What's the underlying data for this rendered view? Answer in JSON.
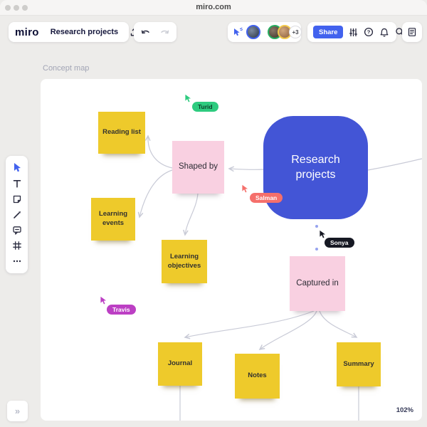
{
  "window": {
    "title": "miro.com"
  },
  "header": {
    "logo": "miro",
    "board_name": "Research projects",
    "share_label": "Share",
    "presence_overflow": "+3",
    "accent": "#4262ee"
  },
  "frame": {
    "label": "Concept map",
    "zoom": "102%",
    "collapse_glyph": "»"
  },
  "board": {
    "nodes": {
      "research_projects": {
        "label": "Research projects",
        "color": "#4355d6"
      },
      "shaped_by": {
        "label": "Shaped by",
        "color": "#f9d0e1"
      },
      "captured_in": {
        "label": "Captured in",
        "color": "#f9d0e1"
      },
      "reading_list": {
        "label": "Reading list",
        "color": "#eeca2b"
      },
      "learning_events": {
        "label": "Learning events",
        "color": "#eeca2b"
      },
      "learning_objectives": {
        "label": "Learning objectives",
        "color": "#eeca2b"
      },
      "journal": {
        "label": "Journal",
        "color": "#eeca2b"
      },
      "notes": {
        "label": "Notes",
        "color": "#eeca2b"
      },
      "summary": {
        "label": "Summary",
        "color": "#eeca2b"
      }
    },
    "collaborators": [
      {
        "name": "Turid",
        "color": "#2ecb7f",
        "text_color": "#0c3f2a"
      },
      {
        "name": "Salman",
        "color": "#f56f6b",
        "text_color": "#ffffff"
      },
      {
        "name": "Sonya",
        "color": "#161823",
        "text_color": "#ffffff"
      },
      {
        "name": "Travis",
        "color": "#bc3fc4",
        "text_color": "#ffffff"
      }
    ],
    "connector_color": "#c8cad6",
    "dotted_connector_color": "#97a3ef"
  },
  "tools": [
    "select",
    "text",
    "sticky-note",
    "pen",
    "comment",
    "frame",
    "more"
  ]
}
